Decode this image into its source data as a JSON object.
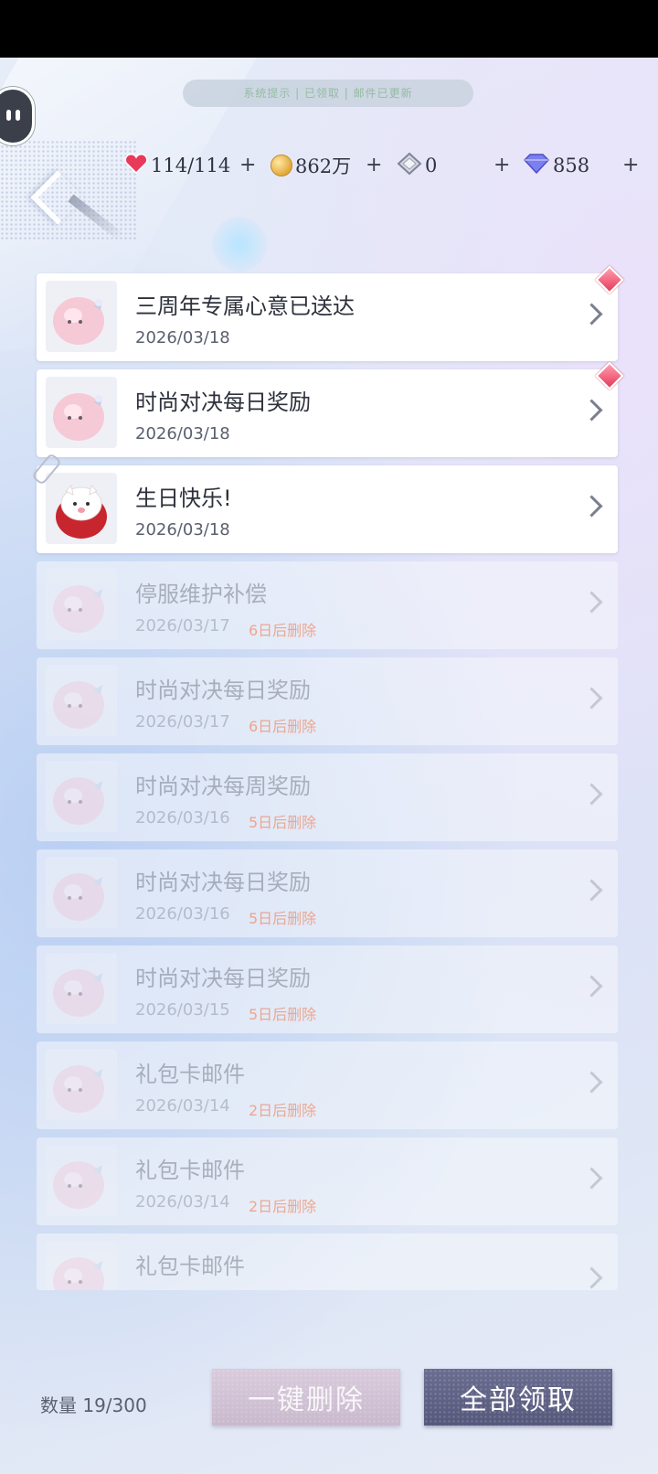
{
  "toast": {
    "text": "系统提示 | 已领取 | 邮件已更新"
  },
  "currencies": {
    "stamina": "114/114",
    "gold": "862万",
    "crystal": "0",
    "diamond": "858"
  },
  "icons": {
    "heart": "heart-icon",
    "coin": "coin-icon",
    "crystal": "crystal-icon",
    "diamond": "diamond-icon"
  },
  "mails": [
    {
      "title": "三周年专属心意已送达",
      "date": "2026/03/18",
      "expire": "",
      "status": "unread",
      "badge": "gem"
    },
    {
      "title": "时尚对决每日奖励",
      "date": "2026/03/18",
      "expire": "",
      "status": "unread",
      "badge": "gem"
    },
    {
      "title": "生日快乐!",
      "date": "2026/03/18",
      "expire": "",
      "status": "unread",
      "badge": "clip"
    },
    {
      "title": "停服维护补偿",
      "date": "2026/03/17",
      "expire": "6日后删除",
      "status": "read"
    },
    {
      "title": "时尚对决每日奖励",
      "date": "2026/03/17",
      "expire": "6日后删除",
      "status": "read"
    },
    {
      "title": "时尚对决每周奖励",
      "date": "2026/03/16",
      "expire": "5日后删除",
      "status": "read"
    },
    {
      "title": "时尚对决每日奖励",
      "date": "2026/03/16",
      "expire": "5日后删除",
      "status": "read"
    },
    {
      "title": "时尚对决每日奖励",
      "date": "2026/03/15",
      "expire": "5日后删除",
      "status": "read"
    },
    {
      "title": "礼包卡邮件",
      "date": "2026/03/14",
      "expire": "2日后删除",
      "status": "read"
    },
    {
      "title": "礼包卡邮件",
      "date": "2026/03/14",
      "expire": "2日后删除",
      "status": "read"
    },
    {
      "title": "礼包卡邮件",
      "date": "",
      "expire": "",
      "status": "read"
    }
  ],
  "footer": {
    "count_label": "数量 19/300",
    "delete_all": "一键删除",
    "claim_all": "全部领取"
  },
  "colors": {
    "accent": "#55587b",
    "expire": "#f2794b",
    "badge": "#e8395a"
  }
}
